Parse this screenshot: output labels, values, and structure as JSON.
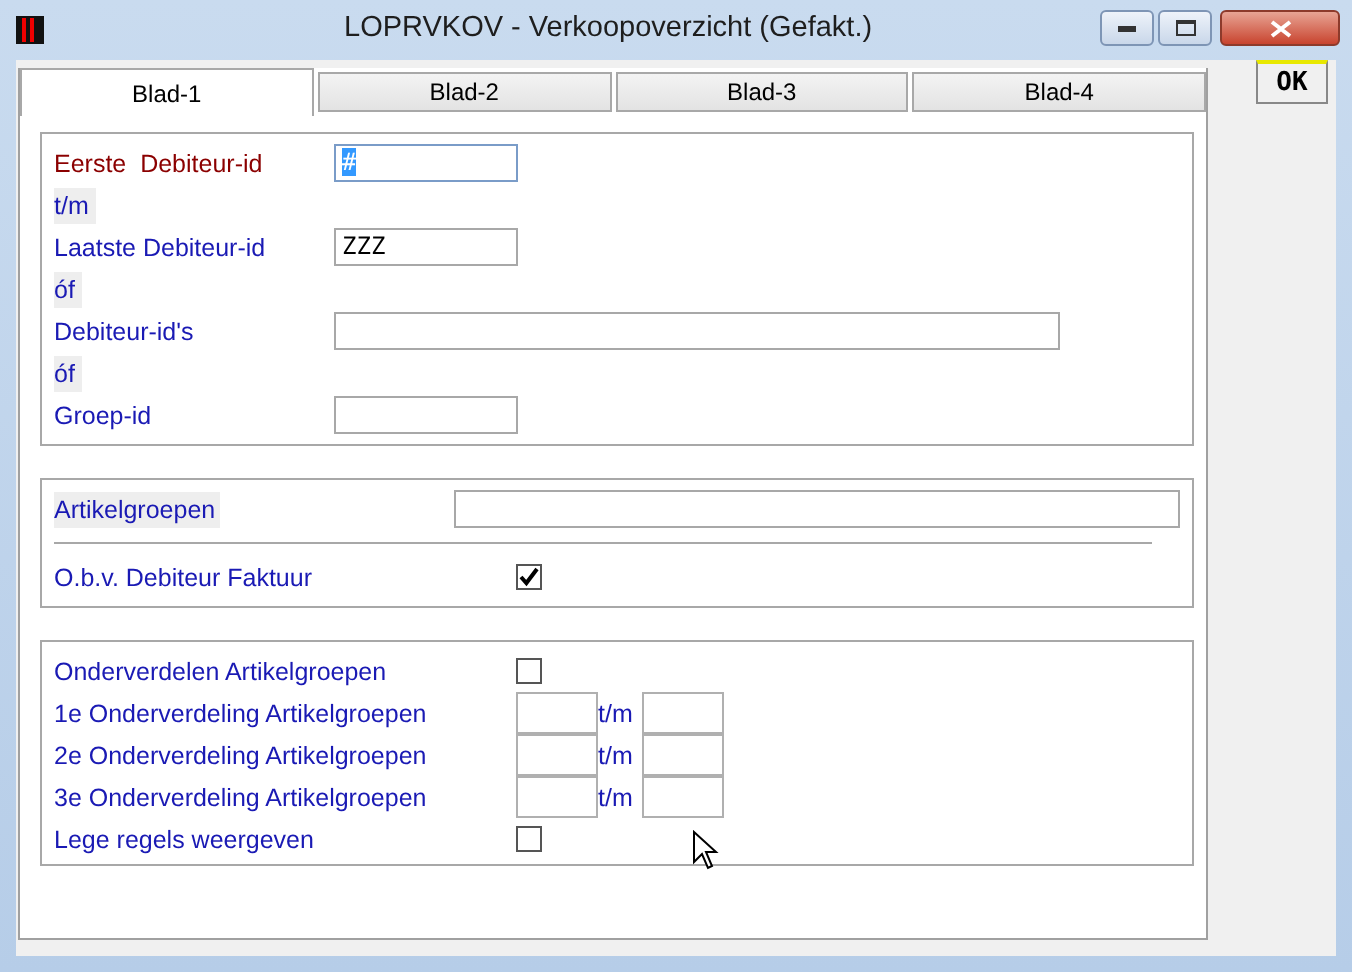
{
  "window": {
    "title": "LOPRVKOV - Verkoopoverzicht (Gefakt.)"
  },
  "tabs": [
    {
      "label": "Blad-1",
      "selected": true
    },
    {
      "label": "Blad-2",
      "selected": false
    },
    {
      "label": "Blad-3",
      "selected": false
    },
    {
      "label": "Blad-4",
      "selected": false
    }
  ],
  "ok_button": "OK",
  "selection_group": [
    {
      "kind": "field",
      "label": "Eerste  Debiteur-id",
      "color": "#8b0000",
      "value": "#",
      "value_selected": true,
      "wide": false
    },
    {
      "kind": "note",
      "label": "t/m"
    },
    {
      "kind": "field",
      "label": "Laatste Debiteur-id",
      "color": "#1a1ab4",
      "value": "ZZZ",
      "value_selected": false,
      "wide": false
    },
    {
      "kind": "note",
      "label": "óf"
    },
    {
      "kind": "field",
      "label": "Debiteur-id's",
      "color": "#1a1ab4",
      "value_selected": false,
      "wide": true
    },
    {
      "kind": "note",
      "label": "óf"
    },
    {
      "kind": "field",
      "label": "Groep-id",
      "color": "#1a1ab4",
      "value_selected": false,
      "wide": false
    }
  ],
  "article_group": {
    "label": "Artikelgroepen",
    "checkbox_label": "O.b.v. Debiteur Faktuur",
    "checked": true
  },
  "subdivision_group": [
    {
      "kind": "checkbox",
      "label": "Onderverdelen Artikelgroepen",
      "checked": false
    },
    {
      "kind": "range",
      "label": "1e Onderverdeling Artikelgroepen",
      "separator": "t/m"
    },
    {
      "kind": "range",
      "label": "2e Onderverdeling Artikelgroepen",
      "separator": "t/m"
    },
    {
      "kind": "range",
      "label": "3e Onderverdeling Artikelgroepen",
      "separator": "t/m"
    },
    {
      "kind": "checkbox",
      "label": "Lege regels weergeven",
      "checked": false
    }
  ]
}
